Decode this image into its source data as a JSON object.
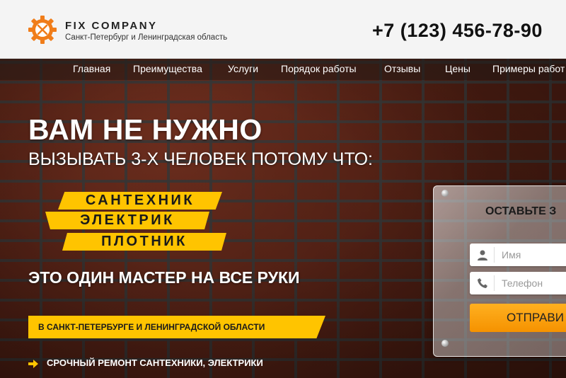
{
  "header": {
    "logo_title": "FIX COMPANY",
    "logo_subtitle": "Санкт-Петербург и Ленинградская область",
    "phone": "+7 (123) 456-78-90"
  },
  "nav": {
    "items": [
      "Главная",
      "Преимущества",
      "Услуги",
      "Порядок работы",
      "Отзывы",
      "Цены",
      "Примеры работ"
    ]
  },
  "hero": {
    "headline": "ВАМ НЕ НУЖНО",
    "subheadline": "ВЫЗЫВАТЬ 3-Х ЧЕЛОВЕК ПОТОМУ ЧТО:",
    "professions": [
      "САНТЕХНИК",
      "ЭЛЕКТРИК",
      "ПЛОТНИК"
    ],
    "tagline": "ЭТО ОДИН МАСТЕР НА ВСЕ РУКИ",
    "region": "В САНКТ-ПЕТЕРБУРГЕ И ЛЕНИНГРАДСКОЙ ОБЛАСТИ",
    "bullet": "СРОЧНЫЙ РЕМОНТ САНТЕХНИКИ, ЭЛЕКТРИКИ"
  },
  "form": {
    "title": "ОСТАВЬТЕ З",
    "name_placeholder": "Имя",
    "phone_placeholder": "Телефон",
    "submit_label": "ОТПРАВИ"
  },
  "colors": {
    "accent": "#ffc400",
    "logo": "#f07d1a",
    "button": "#f59200"
  },
  "icons": {
    "logo": "gear-tools-icon",
    "name": "user-icon",
    "phone": "phone-icon",
    "bullet": "arrow-right-icon"
  }
}
